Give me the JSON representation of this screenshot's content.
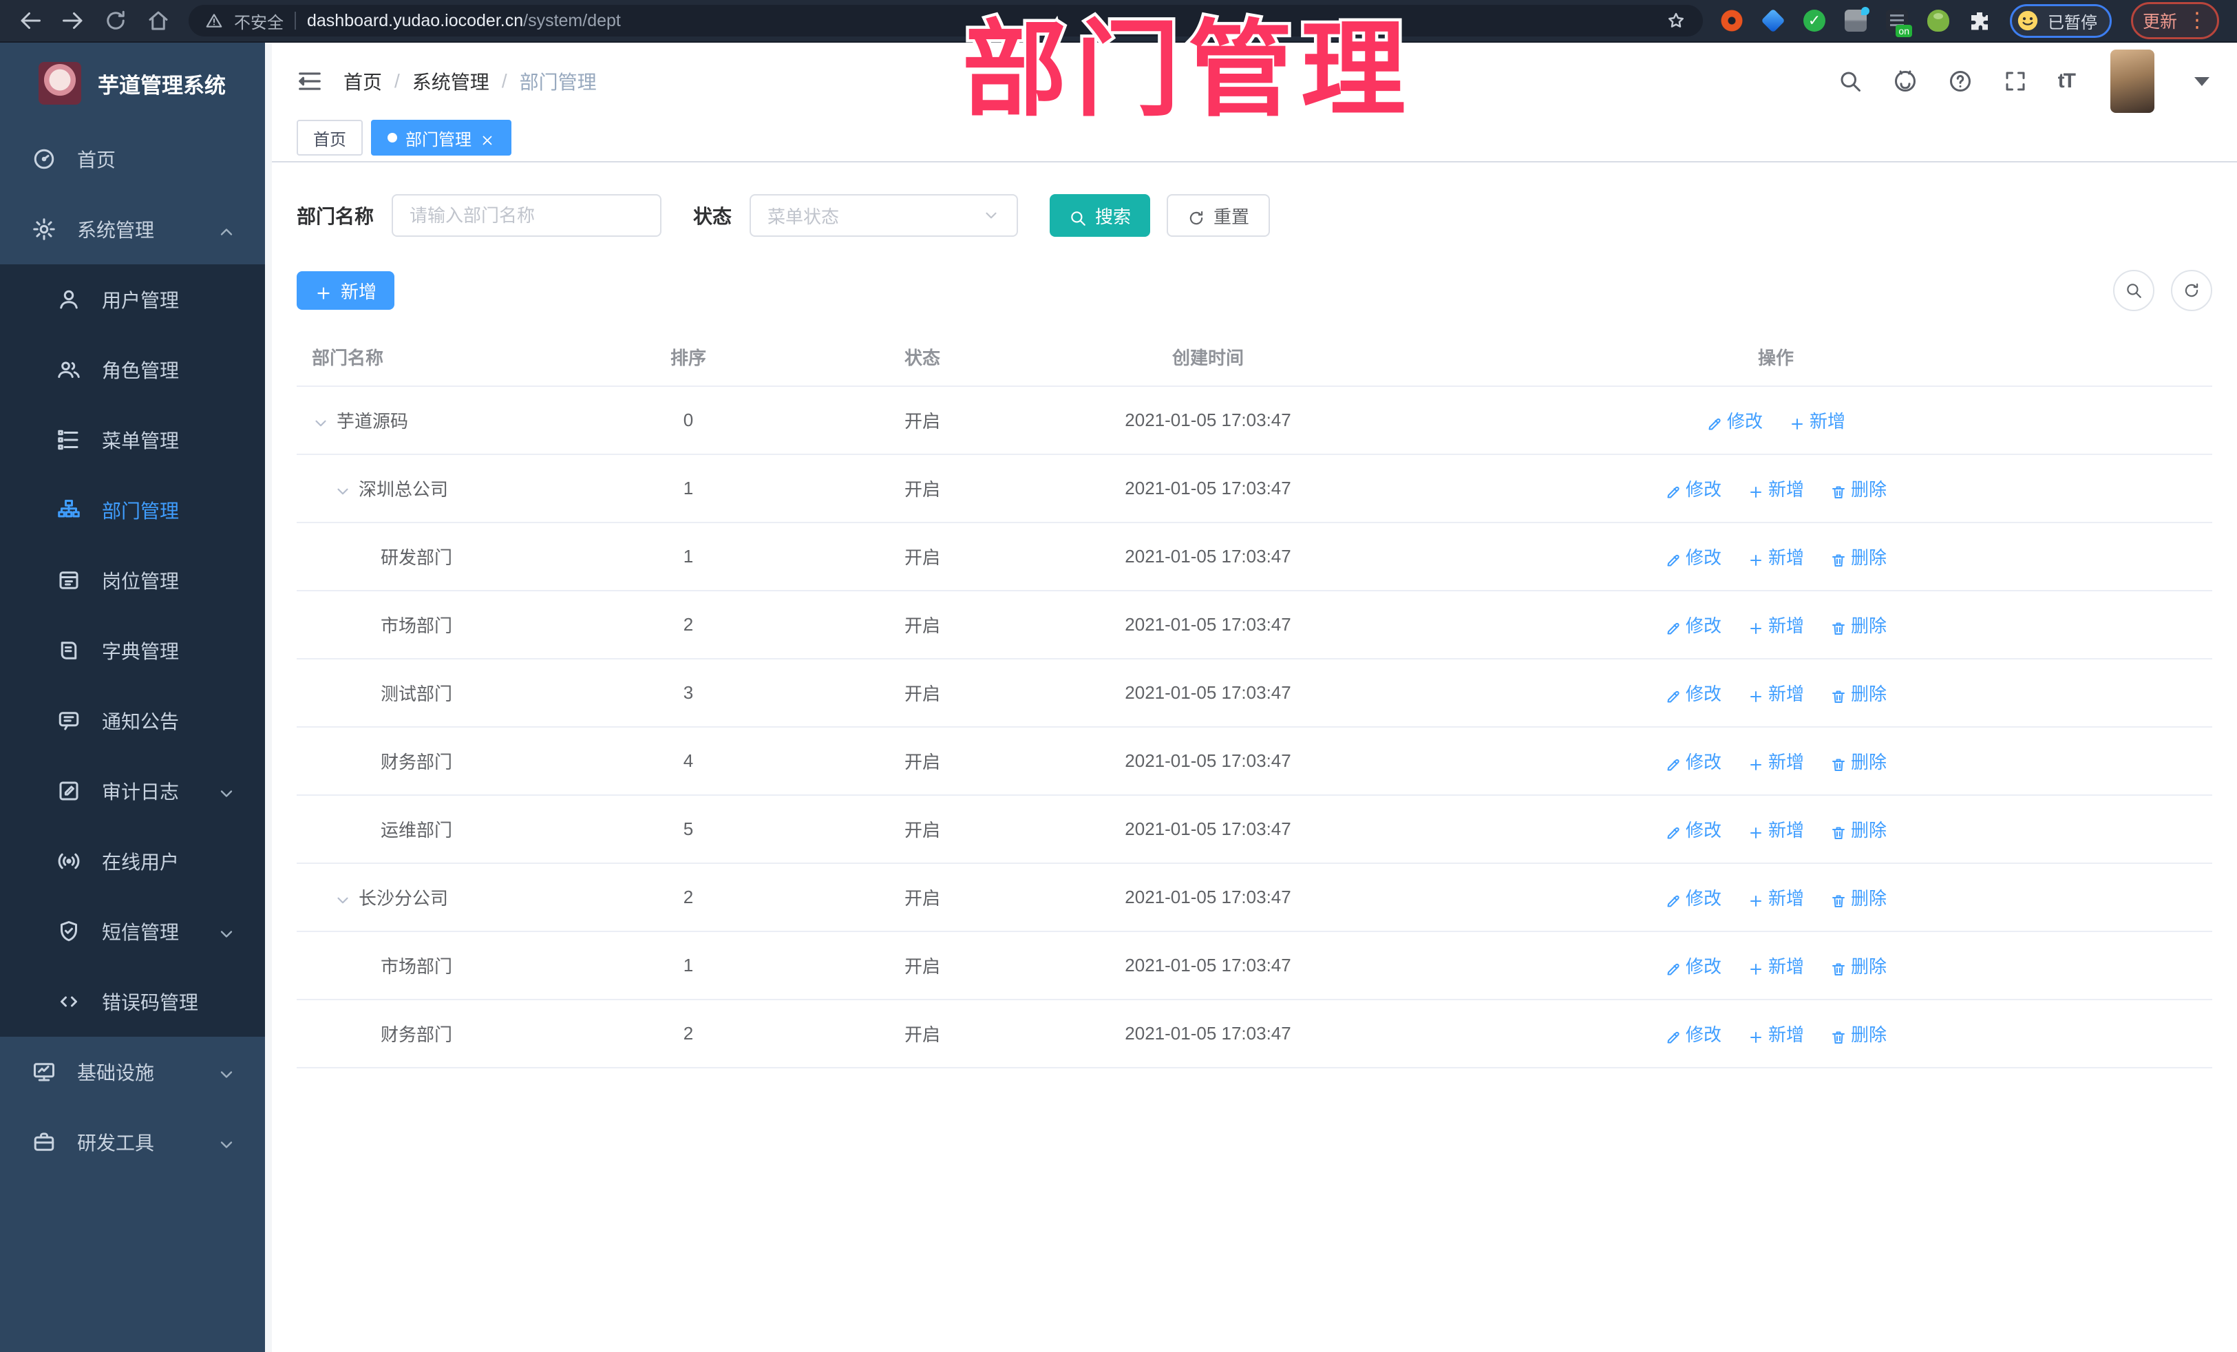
{
  "browser": {
    "security_label": "不安全",
    "url_host": "dashboard.yudao.iocoder.cn",
    "url_path": "/system/dept",
    "paused_label": "已暂停",
    "update_label": "更新"
  },
  "annotation": {
    "title": "部门管理"
  },
  "sidebar": {
    "app_title": "芋道管理系统",
    "items": [
      {
        "label": "首页",
        "icon": "dashboard-icon",
        "level": "root"
      },
      {
        "label": "系统管理",
        "icon": "gear-icon",
        "level": "root",
        "chevron": "up"
      },
      {
        "label": "用户管理",
        "icon": "user-icon",
        "level": "sub"
      },
      {
        "label": "角色管理",
        "icon": "users-icon",
        "level": "sub"
      },
      {
        "label": "菜单管理",
        "icon": "menu-tree-icon",
        "level": "sub"
      },
      {
        "label": "部门管理",
        "icon": "org-chart-icon",
        "level": "sub",
        "active": true
      },
      {
        "label": "岗位管理",
        "icon": "badge-icon",
        "level": "sub"
      },
      {
        "label": "字典管理",
        "icon": "book-icon",
        "level": "sub"
      },
      {
        "label": "通知公告",
        "icon": "megaphone-icon",
        "level": "sub"
      },
      {
        "label": "审计日志",
        "icon": "log-icon",
        "level": "sub",
        "chevron": "down"
      },
      {
        "label": "在线用户",
        "icon": "online-user-icon",
        "level": "sub"
      },
      {
        "label": "短信管理",
        "icon": "sms-icon",
        "level": "sub",
        "chevron": "down"
      },
      {
        "label": "错误码管理",
        "icon": "code-icon",
        "level": "sub"
      },
      {
        "label": "基础设施",
        "icon": "monitor-icon",
        "level": "root",
        "chevron": "down"
      },
      {
        "label": "研发工具",
        "icon": "briefcase-icon",
        "level": "root",
        "chevron": "down"
      }
    ]
  },
  "header": {
    "breadcrumb": [
      "首页",
      "系统管理",
      "部门管理"
    ]
  },
  "tabs": [
    {
      "label": "首页",
      "active": false,
      "closable": false
    },
    {
      "label": "部门管理",
      "active": true,
      "closable": true
    }
  ],
  "filters": {
    "dept_name_label": "部门名称",
    "dept_name_placeholder": "请输入部门名称",
    "status_label": "状态",
    "status_placeholder": "菜单状态",
    "search_label": "搜索",
    "reset_label": "重置"
  },
  "toolbar": {
    "add_label": "新增"
  },
  "table": {
    "columns": [
      {
        "label": "部门名称",
        "align": "left"
      },
      {
        "label": "排序",
        "align": "center"
      },
      {
        "label": "状态",
        "align": "center"
      },
      {
        "label": "创建时间",
        "align": "center"
      },
      {
        "label": "操作",
        "align": "center"
      }
    ],
    "rows": [
      {
        "name": "芋道源码",
        "level": 0,
        "expandable": true,
        "sort": "0",
        "status": "开启",
        "created": "2021-01-05 17:03:47",
        "actions": [
          {
            "label": "修改",
            "icon": "edit-icon"
          },
          {
            "label": "新增",
            "icon": "plus-icon"
          }
        ]
      },
      {
        "name": "深圳总公司",
        "level": 1,
        "expandable": true,
        "sort": "1",
        "status": "开启",
        "created": "2021-01-05 17:03:47",
        "actions": [
          {
            "label": "修改",
            "icon": "edit-icon"
          },
          {
            "label": "新增",
            "icon": "plus-icon"
          },
          {
            "label": "删除",
            "icon": "trash-icon"
          }
        ]
      },
      {
        "name": "研发部门",
        "level": 2,
        "expandable": false,
        "sort": "1",
        "status": "开启",
        "created": "2021-01-05 17:03:47",
        "actions": [
          {
            "label": "修改",
            "icon": "edit-icon"
          },
          {
            "label": "新增",
            "icon": "plus-icon"
          },
          {
            "label": "删除",
            "icon": "trash-icon"
          }
        ]
      },
      {
        "name": "市场部门",
        "level": 2,
        "expandable": false,
        "sort": "2",
        "status": "开启",
        "created": "2021-01-05 17:03:47",
        "actions": [
          {
            "label": "修改",
            "icon": "edit-icon"
          },
          {
            "label": "新增",
            "icon": "plus-icon"
          },
          {
            "label": "删除",
            "icon": "trash-icon"
          }
        ]
      },
      {
        "name": "测试部门",
        "level": 2,
        "expandable": false,
        "sort": "3",
        "status": "开启",
        "created": "2021-01-05 17:03:47",
        "actions": [
          {
            "label": "修改",
            "icon": "edit-icon"
          },
          {
            "label": "新增",
            "icon": "plus-icon"
          },
          {
            "label": "删除",
            "icon": "trash-icon"
          }
        ]
      },
      {
        "name": "财务部门",
        "level": 2,
        "expandable": false,
        "sort": "4",
        "status": "开启",
        "created": "2021-01-05 17:03:47",
        "actions": [
          {
            "label": "修改",
            "icon": "edit-icon"
          },
          {
            "label": "新增",
            "icon": "plus-icon"
          },
          {
            "label": "删除",
            "icon": "trash-icon"
          }
        ]
      },
      {
        "name": "运维部门",
        "level": 2,
        "expandable": false,
        "sort": "5",
        "status": "开启",
        "created": "2021-01-05 17:03:47",
        "actions": [
          {
            "label": "修改",
            "icon": "edit-icon"
          },
          {
            "label": "新增",
            "icon": "plus-icon"
          },
          {
            "label": "删除",
            "icon": "trash-icon"
          }
        ]
      },
      {
        "name": "长沙分公司",
        "level": 1,
        "expandable": true,
        "sort": "2",
        "status": "开启",
        "created": "2021-01-05 17:03:47",
        "actions": [
          {
            "label": "修改",
            "icon": "edit-icon"
          },
          {
            "label": "新增",
            "icon": "plus-icon"
          },
          {
            "label": "删除",
            "icon": "trash-icon"
          }
        ]
      },
      {
        "name": "市场部门",
        "level": 2,
        "expandable": false,
        "sort": "1",
        "status": "开启",
        "created": "2021-01-05 17:03:47",
        "actions": [
          {
            "label": "修改",
            "icon": "edit-icon"
          },
          {
            "label": "新增",
            "icon": "plus-icon"
          },
          {
            "label": "删除",
            "icon": "trash-icon"
          }
        ]
      },
      {
        "name": "财务部门",
        "level": 2,
        "expandable": false,
        "sort": "2",
        "status": "开启",
        "created": "2021-01-05 17:03:47",
        "actions": [
          {
            "label": "修改",
            "icon": "edit-icon"
          },
          {
            "label": "新增",
            "icon": "plus-icon"
          },
          {
            "label": "删除",
            "icon": "trash-icon"
          }
        ]
      }
    ]
  },
  "colors": {
    "accent_blue": "#409eff",
    "search_teal": "#18b3aa",
    "annotation_pink": "#fb3560",
    "sidebar_bg": "#2e4660",
    "submenu_bg": "#1d2c3e"
  }
}
